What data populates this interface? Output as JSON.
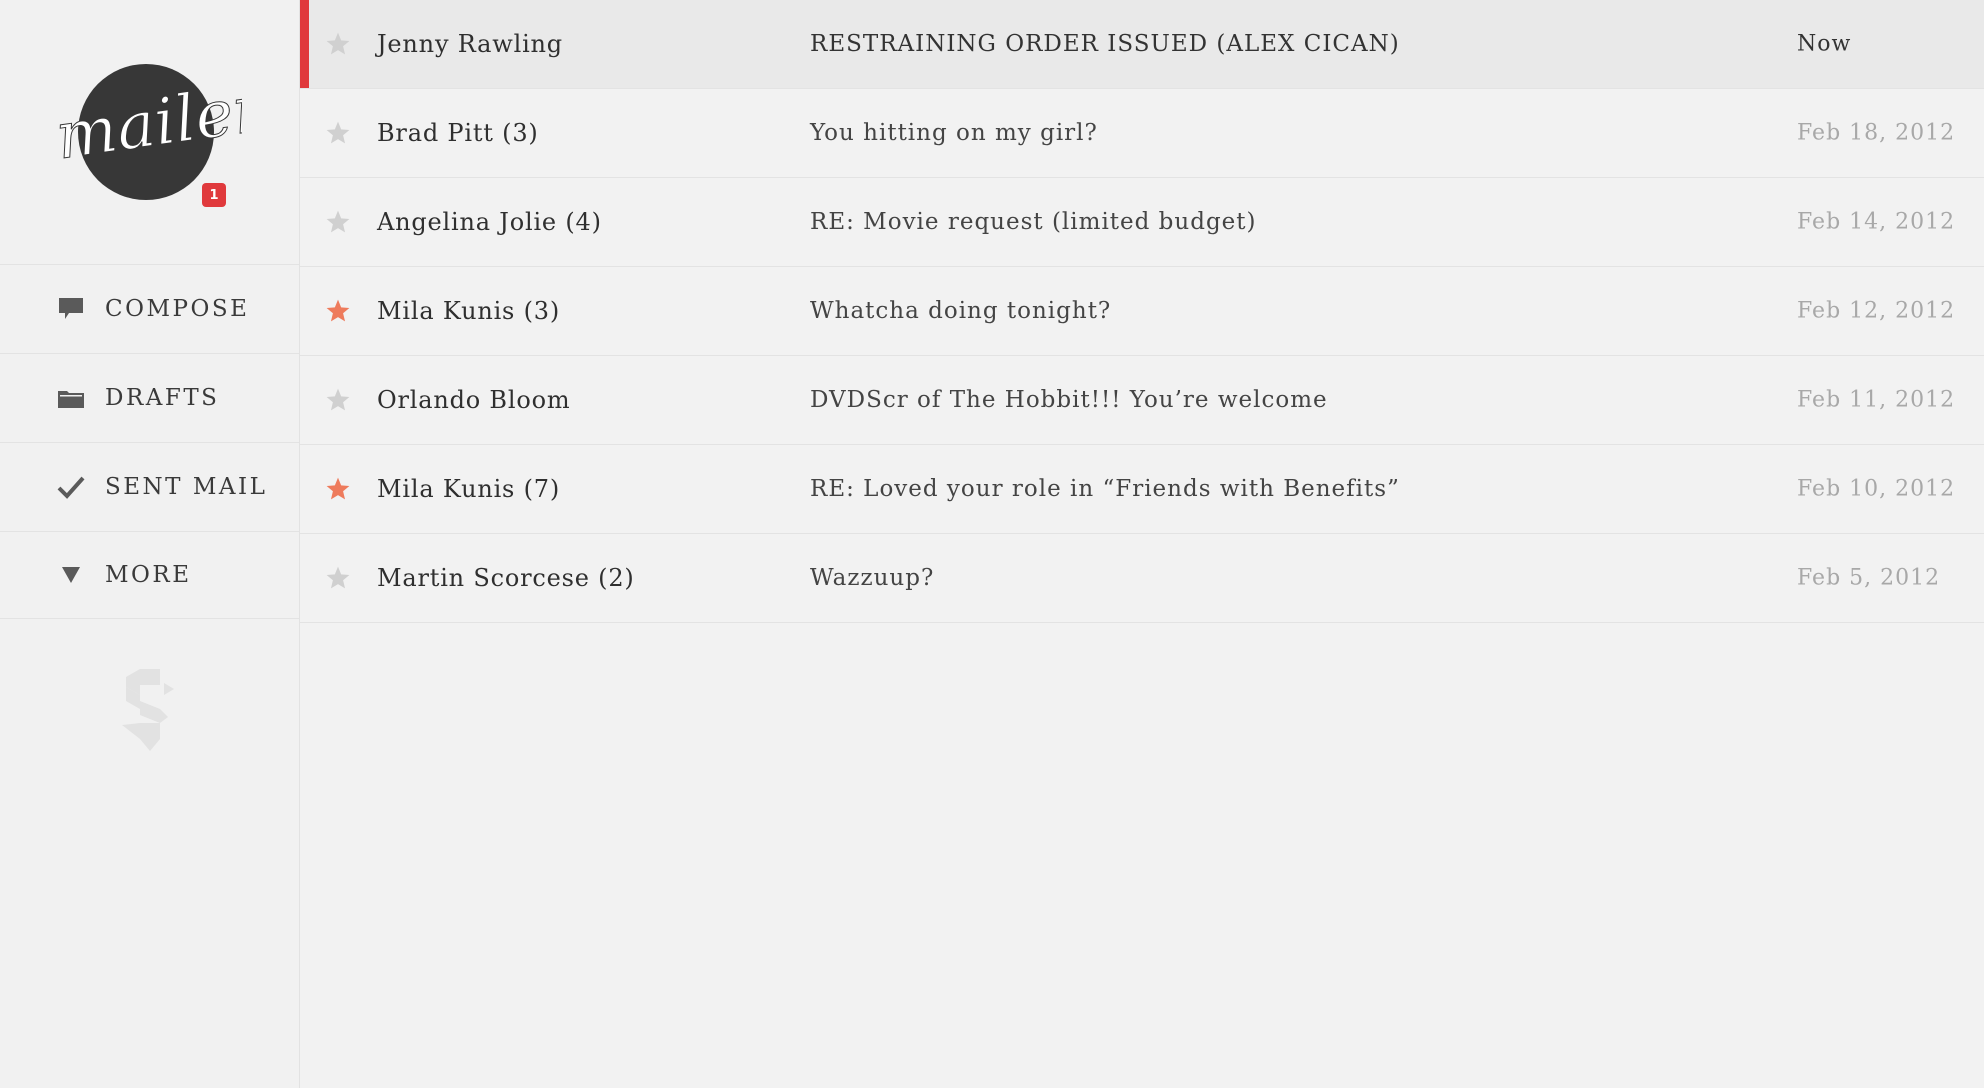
{
  "app": {
    "logo_text": "mailer",
    "unread_badge": "1"
  },
  "nav": [
    {
      "label": "COMPOSE",
      "icon": "speech-bubble-icon"
    },
    {
      "label": "DRAFTS",
      "icon": "folder-icon"
    },
    {
      "label": "SENT MAIL",
      "icon": "checkmark-icon"
    },
    {
      "label": "MORE",
      "icon": "triangle-down-icon"
    }
  ],
  "colors": {
    "accent_red": "#e0393c",
    "star_active": "#ee7b5c",
    "star_inactive": "#cfcfcf"
  },
  "messages": [
    {
      "sender": "Jenny Rawling",
      "subject": "RESTRAINING ORDER ISSUED (ALEX CICAN)",
      "date": "Now",
      "starred": false,
      "unread": true
    },
    {
      "sender": "Brad Pitt (3)",
      "subject": "You hitting on my girl?",
      "date": "Feb 18, 2012",
      "starred": false,
      "unread": false
    },
    {
      "sender": "Angelina Jolie (4)",
      "subject": "RE: Movie request (limited budget)",
      "date": "Feb 14, 2012",
      "starred": false,
      "unread": false
    },
    {
      "sender": "Mila Kunis (3)",
      "subject": "Whatcha doing tonight?",
      "date": "Feb 12, 2012",
      "starred": true,
      "unread": false
    },
    {
      "sender": "Orlando Bloom",
      "subject": "DVDScr of The Hobbit!!! You’re welcome",
      "date": "Feb 11, 2012",
      "starred": false,
      "unread": false
    },
    {
      "sender": "Mila Kunis (7)",
      "subject": "RE: Loved your role in “Friends with Benefits”",
      "date": "Feb 10, 2012",
      "starred": true,
      "unread": false
    },
    {
      "sender": "Martin Scorcese (2)",
      "subject": "Wazzuup?",
      "date": "Feb 5, 2012",
      "starred": false,
      "unread": false
    }
  ]
}
